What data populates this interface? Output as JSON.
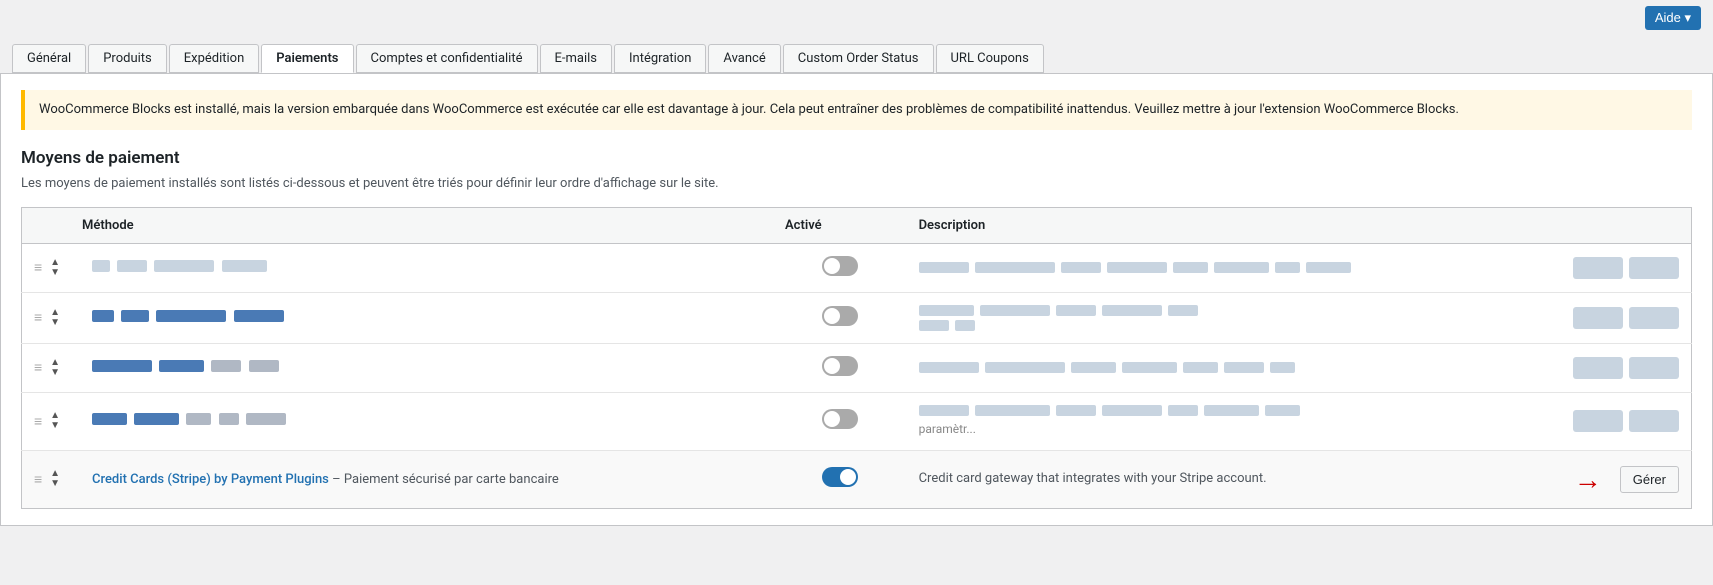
{
  "topbar": {
    "aide_label": "Aide ▾"
  },
  "tabs": [
    {
      "id": "general",
      "label": "Général",
      "active": false
    },
    {
      "id": "produits",
      "label": "Produits",
      "active": false
    },
    {
      "id": "expedition",
      "label": "Expédition",
      "active": false
    },
    {
      "id": "paiements",
      "label": "Paiements",
      "active": true
    },
    {
      "id": "comptes",
      "label": "Comptes et confidentialité",
      "active": false
    },
    {
      "id": "emails",
      "label": "E-mails",
      "active": false
    },
    {
      "id": "integration",
      "label": "Intégration",
      "active": false
    },
    {
      "id": "avance",
      "label": "Avancé",
      "active": false
    },
    {
      "id": "custom-order",
      "label": "Custom Order Status",
      "active": false
    },
    {
      "id": "url-coupons",
      "label": "URL Coupons",
      "active": false
    }
  ],
  "notice": {
    "text": "WooCommerce Blocks est installé, mais la version embarquée dans WooCommerce est exécutée car elle est davantage à jour. Cela peut entraîner des problèmes de compatibilité inattendus. Veuillez mettre à jour l'extension WooCommerce Blocks."
  },
  "section": {
    "title": "Moyens de paiement",
    "description": "Les moyens de paiement installés sont listés ci-dessous et peuvent être triés pour définir leur ordre d'affichage sur le site."
  },
  "table": {
    "headers": {
      "methode": "Méthode",
      "active": "Activé",
      "description": "Description"
    },
    "rows": [
      {
        "id": "row1",
        "method_name_blurred": true,
        "active": false,
        "desc_blurred": true,
        "has_action_blurred": true
      },
      {
        "id": "row2",
        "method_name_blurred": true,
        "active": false,
        "desc_blurred": true,
        "has_action_blurred": true
      },
      {
        "id": "row3",
        "method_name_blurred": true,
        "active": false,
        "desc_blurred": true,
        "has_action_blurred": true
      },
      {
        "id": "row4",
        "method_name_blurred": true,
        "active": false,
        "desc_blurred": true,
        "has_action_blurred": true,
        "has_sub_blurred": true
      },
      {
        "id": "row5",
        "method_link": "Credit Cards (Stripe) by Payment Plugins",
        "method_subtitle": "– Paiement sécurisé par carte bancaire",
        "active": true,
        "description": "Credit card gateway that integrates with your Stripe account.",
        "action_label": "Gérer",
        "has_arrow": true
      }
    ]
  }
}
